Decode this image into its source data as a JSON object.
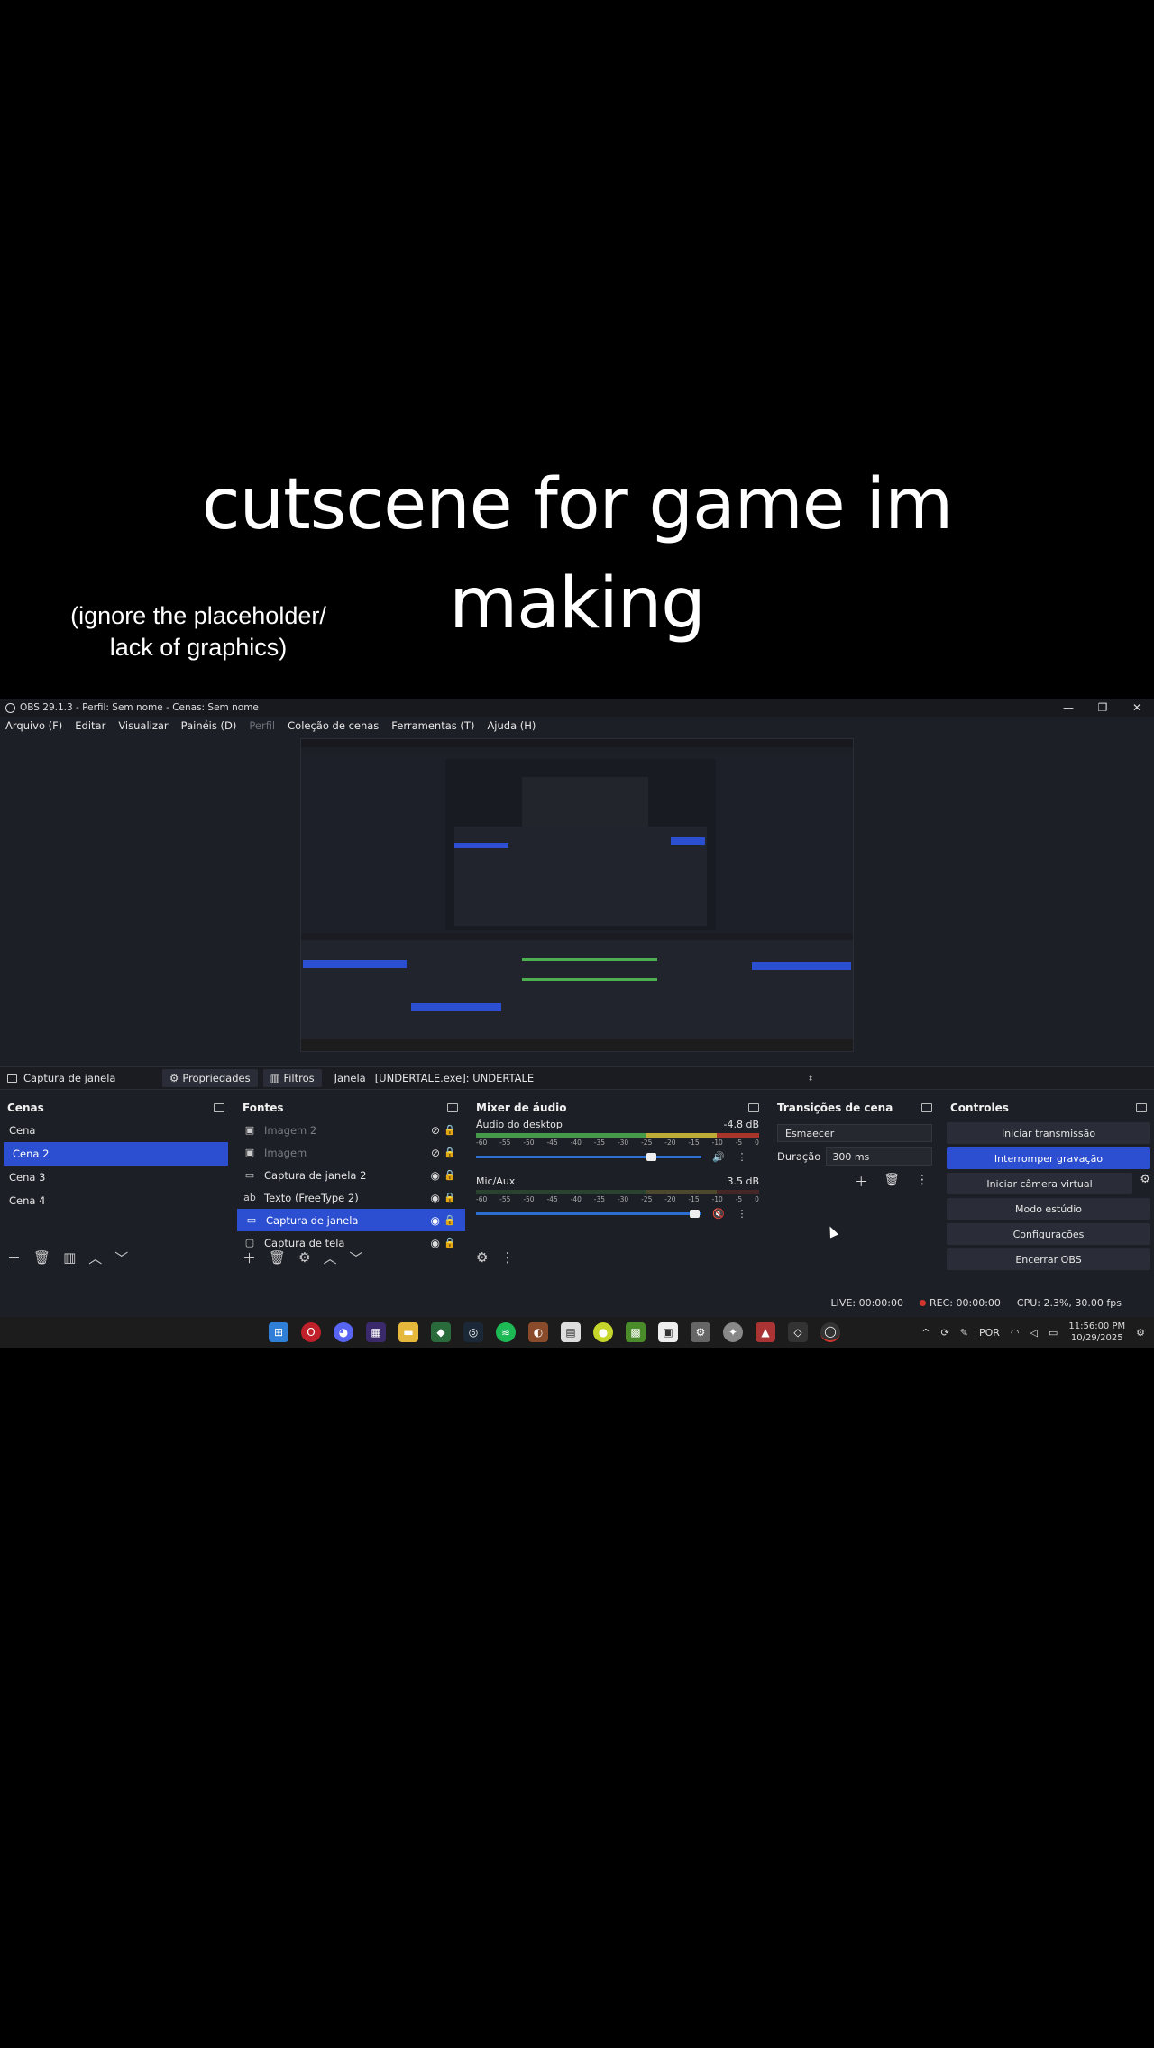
{
  "caption": {
    "main": "cutscene for game im making",
    "side": "(ignore the placeholder/ lack of graphics)"
  },
  "window": {
    "title": "OBS 29.1.3 - Perfil: Sem nome - Cenas: Sem nome",
    "controls": [
      "—",
      "❐",
      "✕"
    ]
  },
  "menu": [
    {
      "label": "Arquivo (F)",
      "dim": false
    },
    {
      "label": "Editar",
      "dim": false
    },
    {
      "label": "Visualizar",
      "dim": false
    },
    {
      "label": "Painéis (D)",
      "dim": false
    },
    {
      "label": "Perfil",
      "dim": true
    },
    {
      "label": "Coleção de cenas",
      "dim": false
    },
    {
      "label": "Ferramentas (T)",
      "dim": false
    },
    {
      "label": "Ajuda (H)",
      "dim": false
    }
  ],
  "sourcebar": {
    "selected_source": "Captura de janela",
    "properties": "Propriedades",
    "filters": "Filtros",
    "window_label": "Janela",
    "window_value": "[UNDERTALE.exe]: UNDERTALE"
  },
  "scenes": {
    "title": "Cenas",
    "items": [
      {
        "label": "Cena",
        "selected": false
      },
      {
        "label": "Cena 2",
        "selected": true
      },
      {
        "label": "Cena 3",
        "selected": false
      },
      {
        "label": "Cena 4",
        "selected": false
      }
    ]
  },
  "sources": {
    "title": "Fontes",
    "items": [
      {
        "label": "Imagem 2",
        "icon": "image-icon",
        "visible": false,
        "selected": false
      },
      {
        "label": "Imagem",
        "icon": "image-icon",
        "visible": false,
        "selected": false
      },
      {
        "label": "Captura de janela 2",
        "icon": "window-icon",
        "visible": true,
        "selected": false
      },
      {
        "label": "Texto (FreeType 2)",
        "icon": "text-icon",
        "visible": true,
        "selected": false
      },
      {
        "label": "Captura de janela",
        "icon": "window-icon",
        "visible": true,
        "selected": true
      },
      {
        "label": "Captura de tela",
        "icon": "display-icon",
        "visible": true,
        "selected": false
      }
    ]
  },
  "mixer": {
    "title": "Mixer de áudio",
    "ticks": [
      "-60",
      "-55",
      "-50",
      "-45",
      "-40",
      "-35",
      "-30",
      "-25",
      "-20",
      "-15",
      "-10",
      "-5",
      "0"
    ],
    "channels": [
      {
        "name": "Áudio do desktop",
        "db": "-4.8 dB",
        "level": 0.78,
        "muted": false
      },
      {
        "name": "Mic/Aux",
        "db": "3.5 dB",
        "level": 0.97,
        "muted": true
      }
    ]
  },
  "transitions": {
    "title": "Transições de cena",
    "selected": "Esmaecer",
    "duration_label": "Duração",
    "duration_value": "300 ms"
  },
  "controls": {
    "title": "Controles",
    "buttons": [
      {
        "label": "Iniciar transmissão",
        "active": false
      },
      {
        "label": "Interromper gravação",
        "active": true
      },
      {
        "label": "Iniciar câmera virtual",
        "active": false
      },
      {
        "label": "Modo estúdio",
        "active": false
      },
      {
        "label": "Configurações",
        "active": false
      },
      {
        "label": "Encerrar OBS",
        "active": false
      }
    ]
  },
  "status": {
    "live": "LIVE: 00:00:00",
    "rec": "REC: 00:00:00",
    "cpu": "CPU: 2.3%, 30.00 fps"
  },
  "taskbar": {
    "language": "POR",
    "time": "11:56:00 PM",
    "date": "10/29/2025"
  },
  "colors": {
    "accent": "#2c4fd1",
    "panel": "#1d1f26",
    "rec": "#d0362c"
  }
}
